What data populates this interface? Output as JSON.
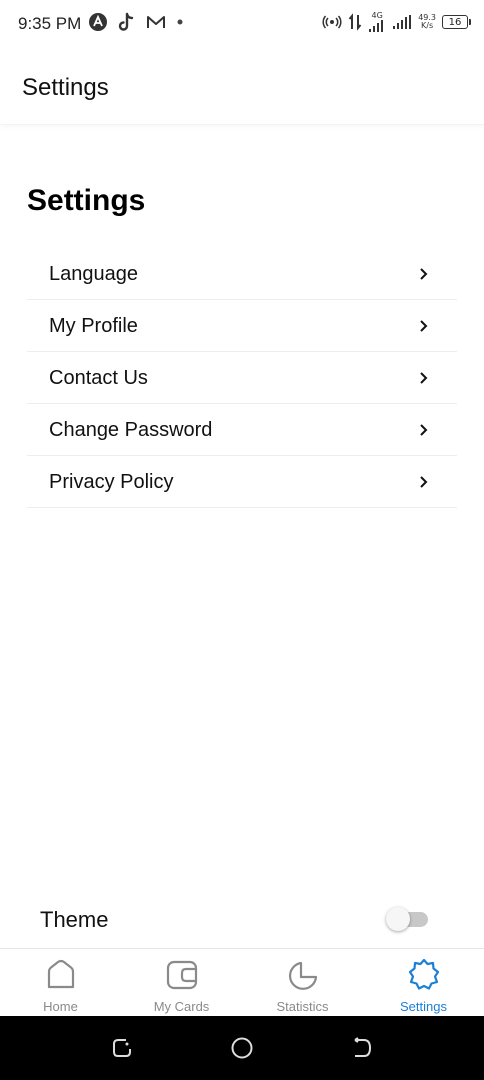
{
  "status_bar": {
    "time": "9:35 PM",
    "network_type": "4G",
    "speed_value": "49.3",
    "speed_unit": "K/s",
    "battery": "16"
  },
  "header": {
    "title": "Settings"
  },
  "section": {
    "title": "Settings"
  },
  "menu": {
    "items": [
      {
        "label": "Language"
      },
      {
        "label": "My Profile"
      },
      {
        "label": "Contact Us"
      },
      {
        "label": "Change Password"
      },
      {
        "label": "Privacy Policy"
      }
    ]
  },
  "theme": {
    "label": "Theme",
    "toggle_on": false
  },
  "bottom_nav": {
    "items": [
      {
        "label": "Home",
        "icon": "home-icon"
      },
      {
        "label": "My Cards",
        "icon": "wallet-icon"
      },
      {
        "label": "Statistics",
        "icon": "pie-chart-icon"
      },
      {
        "label": "Settings",
        "icon": "gear-icon",
        "active": true
      }
    ]
  },
  "colors": {
    "accent": "#1c7fd6",
    "inactive": "#8a8a8a"
  }
}
